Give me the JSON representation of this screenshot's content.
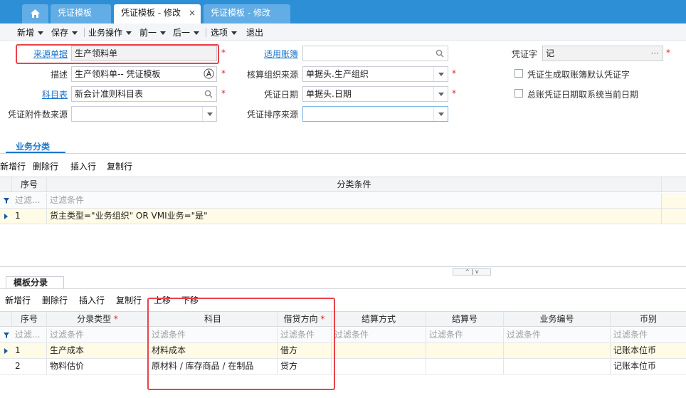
{
  "tabs": {
    "home": "home-icon",
    "items": [
      {
        "label": "凭证模板"
      },
      {
        "label": "凭证模板 - 修改",
        "active": true
      },
      {
        "label": "凭证模板 - 修改"
      }
    ],
    "close": "×"
  },
  "toolbar": {
    "new": "新增",
    "save": "保存",
    "business_ops": "业务操作",
    "prev": "前一",
    "next": "后一",
    "options": "选项",
    "exit": "退出"
  },
  "form": {
    "source_doc": {
      "label": "来源单据",
      "value": "生产领料单"
    },
    "book": {
      "label": "适用账簿",
      "value": ""
    },
    "voucher_word": {
      "label": "凭证字",
      "value": "记",
      "ellipsis": "···"
    },
    "description": {
      "label": "描述",
      "value": "生产领料单-- 凭证模板"
    },
    "acct_org_source": {
      "label": "核算组织来源",
      "value": "单据头.生产组织"
    },
    "chk_default_word": {
      "label": "凭证生成取账簿默认凭证字",
      "checked": false
    },
    "chart": {
      "label": "科目表",
      "value": "新会计准则科目表"
    },
    "voucher_date": {
      "label": "凭证日期",
      "value": "单据头.日期"
    },
    "chk_current_date": {
      "label": "总账凭证日期取系统当前日期",
      "checked": false
    },
    "attach_source": {
      "label": "凭证附件数来源",
      "value": ""
    },
    "sort_source": {
      "label": "凭证排序来源",
      "value": ""
    },
    "required_mark": "*"
  },
  "category_section": {
    "title": "业务分类",
    "actions": {
      "add": "新增行",
      "delete": "删除行",
      "insert": "插入行",
      "copy": "复制行"
    },
    "columns": {
      "seq": "序号",
      "condition": "分类条件"
    },
    "filter": {
      "seq": "过滤...",
      "condition": "过滤条件"
    },
    "rows": [
      {
        "seq": "1",
        "condition": "货主类型=\"业务组织\" OR VMI业务=\"是\""
      }
    ]
  },
  "splitter": {
    "up": "^",
    "down": "v"
  },
  "entry_section": {
    "title": "模板分录",
    "actions": {
      "add": "新增行",
      "delete": "删除行",
      "insert": "插入行",
      "copy": "复制行",
      "up": "上移",
      "down": "下移"
    },
    "columns": {
      "seq": "序号",
      "entry_type": "分录类型",
      "account": "科目",
      "direction": "借贷方向",
      "settle_method": "结算方式",
      "settle_no": "结算号",
      "biz_no": "业务编号",
      "currency": "币别"
    },
    "filter": {
      "seq": "过滤...",
      "entry_type": "过滤条件",
      "account": "过滤条件",
      "direction": "过滤条件",
      "settle_method": "过滤条件",
      "settle_no": "过滤条件",
      "biz_no": "过滤条件",
      "currency": "过滤条件"
    },
    "rows": [
      {
        "seq": "1",
        "entry_type": "生产成本",
        "account": "材料成本",
        "direction": "借方",
        "settle_method": "",
        "settle_no": "",
        "biz_no": "",
        "currency": "记账本位币"
      },
      {
        "seq": "2",
        "entry_type": "物料估价",
        "account": "原材料 / 库存商品 / 在制品",
        "direction": "贷方",
        "settle_method": "",
        "settle_no": "",
        "biz_no": "",
        "currency": "记账本位币"
      }
    ]
  },
  "colors": {
    "accent": "#2d8fd6",
    "link": "#1b75c8",
    "required": "#e0262c",
    "highlight_box": "#e8434b",
    "selected_row": "#fffbe6"
  }
}
